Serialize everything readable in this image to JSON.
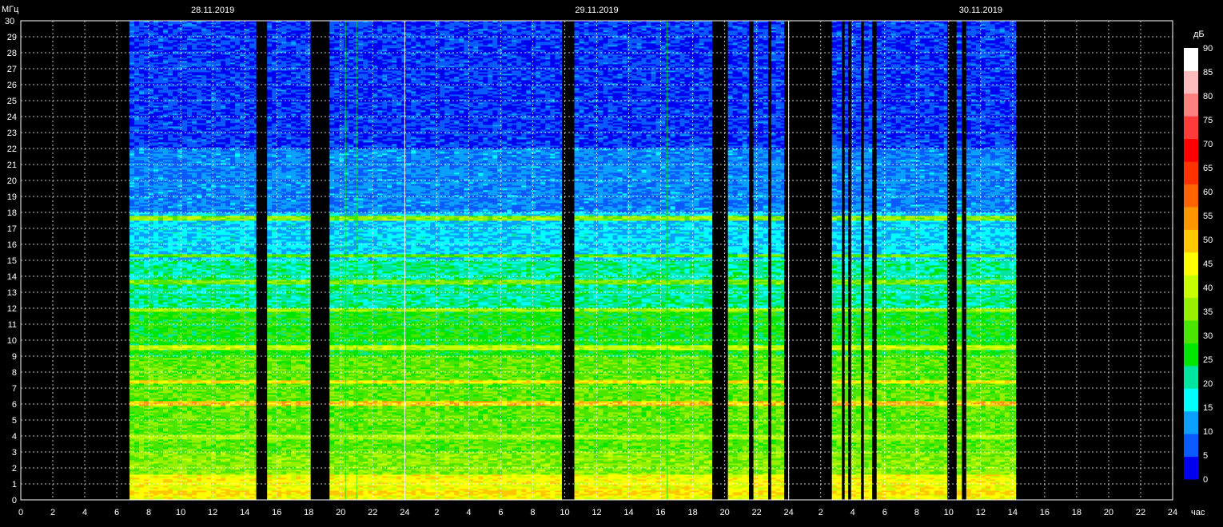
{
  "chart_data": {
    "type": "heatmap",
    "y_unit_label": "МГц",
    "x_unit_label": "час",
    "colorbar_unit_label": "дБ",
    "ylim": [
      0,
      30
    ],
    "y_ticks": [
      "0",
      "1",
      "2",
      "3",
      "4",
      "5",
      "6",
      "7",
      "8",
      "9",
      "10",
      "11",
      "12",
      "13",
      "14",
      "15",
      "16",
      "17",
      "18",
      "19",
      "20",
      "21",
      "22",
      "23",
      "24",
      "25",
      "26",
      "27",
      "28",
      "29",
      "30"
    ],
    "x_ticks": [
      "0",
      "2",
      "4",
      "6",
      "8",
      "10",
      "12",
      "14",
      "16",
      "18",
      "20",
      "22",
      "24",
      "2",
      "4",
      "6",
      "8",
      "10",
      "12",
      "14",
      "16",
      "18",
      "20",
      "22",
      "24",
      "2",
      "4",
      "6",
      "8",
      "10",
      "12",
      "14",
      "16",
      "18",
      "20",
      "22",
      "24"
    ],
    "x_range_hours": [
      0,
      72
    ],
    "dates": [
      {
        "label": "28.11.2019",
        "at_hour": 12
      },
      {
        "label": "29.11.2019",
        "at_hour": 36
      },
      {
        "label": "30.11.2019",
        "at_hour": 60
      }
    ],
    "colorbar_ticks": [
      "0",
      "5",
      "10",
      "15",
      "20",
      "25",
      "30",
      "35",
      "40",
      "45",
      "50",
      "55",
      "60",
      "65",
      "70",
      "75",
      "80",
      "85",
      "90"
    ],
    "colorbar_range": [
      0,
      90
    ],
    "colorbar_colors": [
      "#0000f0",
      "#0a5aff",
      "#0aa0ff",
      "#00ffff",
      "#00e6a0",
      "#00e600",
      "#4be600",
      "#96f000",
      "#c8ff00",
      "#ffff00",
      "#ffc800",
      "#ff9600",
      "#ff6400",
      "#ff3200",
      "#ff0000",
      "#ff3c3c",
      "#ff8080",
      "#ffbcbc",
      "#ffffff"
    ],
    "grid": true,
    "data_segments_hours": [
      [
        6.8,
        14.7
      ],
      [
        15.4,
        18.1
      ],
      [
        19.3,
        33.8
      ],
      [
        34.6,
        43.2
      ],
      [
        44.2,
        45.5
      ],
      [
        45.8,
        46.7
      ],
      [
        46.9,
        47.7
      ],
      [
        50.7,
        51.3
      ],
      [
        51.5,
        51.7
      ],
      [
        51.9,
        52.5
      ],
      [
        52.7,
        53.2
      ],
      [
        53.5,
        57.9
      ],
      [
        58.5,
        58.8
      ],
      [
        59.1,
        62.2
      ]
    ],
    "persistent_line_hours": [
      20.3,
      21.0,
      40.4
    ],
    "enhanced_bands_mhz": [
      {
        "mhz": 0.5,
        "level_db": 52
      },
      {
        "mhz": 1.3,
        "level_db": 48
      },
      {
        "mhz": 4.0,
        "level_db": 42
      },
      {
        "mhz": 6.1,
        "level_db": 55
      },
      {
        "mhz": 7.4,
        "level_db": 52
      },
      {
        "mhz": 9.6,
        "level_db": 45
      },
      {
        "mhz": 11.9,
        "level_db": 42
      },
      {
        "mhz": 13.7,
        "level_db": 38
      },
      {
        "mhz": 15.3,
        "level_db": 36
      },
      {
        "mhz": 17.7,
        "level_db": 40
      }
    ]
  }
}
